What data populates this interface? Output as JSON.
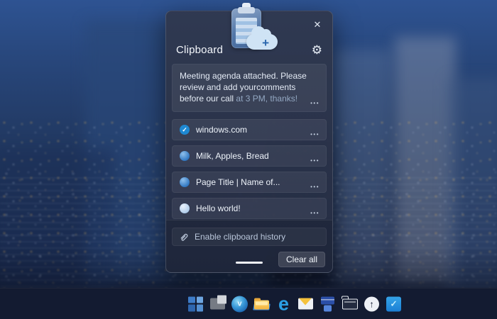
{
  "colors": {
    "accent_blue": "#1e88d2",
    "panel_background": "#2c3550",
    "taskbar_background": "#131b31",
    "text_primary": "#eef3fa",
    "text_dim": "#93a7c2"
  },
  "panel": {
    "title": "Clipboard",
    "close_icon": "✕",
    "settings_icon": "⚙",
    "more_glyph": "•••",
    "check_glyph": "✓",
    "snippet": {
      "text": "Meeting agenda attached. Please review and add yourcomments before our call ",
      "text_dim": "at 3 PM, thanks!"
    },
    "items": [
      {
        "label": "windows.com",
        "icon": "check-circle-icon"
      },
      {
        "label": "Milk, Apples, Bread",
        "icon": "blue-dot-icon"
      },
      {
        "label": "Page Title | Name of...",
        "icon": "blue-dot-icon"
      },
      {
        "label": "Hello world!",
        "icon": "light-dot-icon"
      }
    ],
    "enable_label": "Enable clipboard history",
    "clear_all_label": "Clear all",
    "big_icon": {
      "name": "clipboard-cloud-add-icon",
      "plus_glyph": "+"
    }
  },
  "taskbar": {
    "icons": [
      "start-icon",
      "explorer-gray-icon",
      "cortana-icon",
      "file-explorer-icon",
      "edge-icon",
      "mail-icon",
      "blue-app-icon",
      "folder-outline-icon",
      "sync-icon",
      "todo-check-icon"
    ],
    "edge_glyph": "e",
    "cortana_glyph": "v",
    "sync_glyph": "↑",
    "todo_glyph": "✓"
  }
}
